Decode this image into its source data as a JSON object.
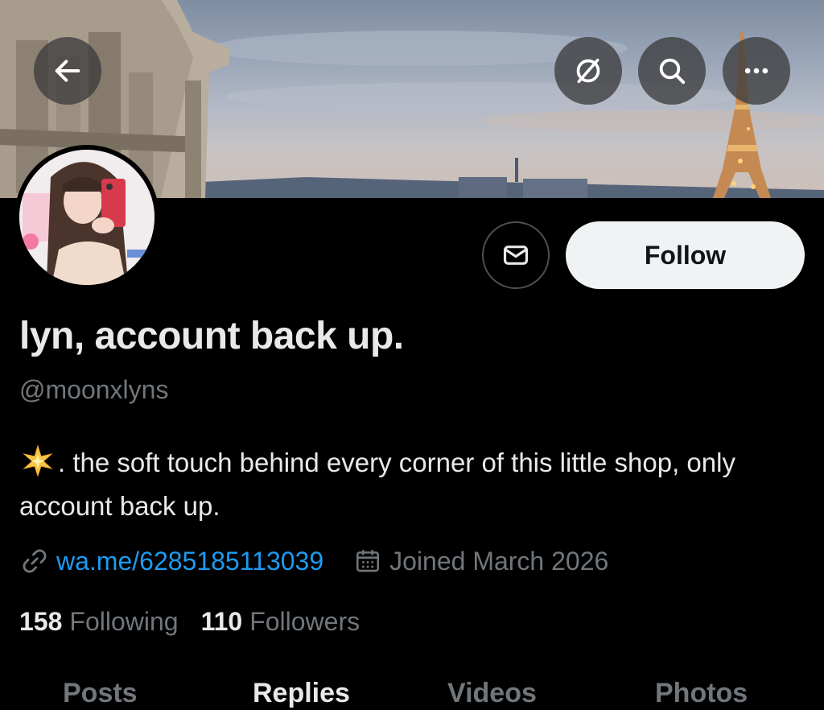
{
  "header": {
    "back_icon": "arrow-left-icon",
    "grok_icon": "grok-slash-circle-icon",
    "search_icon": "search-icon",
    "more_icon": "more-horizontal-icon"
  },
  "profile": {
    "display_name": "lyn, account back up.",
    "handle": "@moonxlyns",
    "bio_emoji": "sparkle-star",
    "bio": ". the soft touch behind every corner of this little shop, only account back up.",
    "link": "wa.me/6285185113039",
    "joined": "Joined March 2026",
    "following_count": "158",
    "following_label": "Following",
    "followers_count": "110",
    "followers_label": "Followers"
  },
  "actions": {
    "message_icon": "envelope-icon",
    "follow_label": "Follow"
  },
  "tabs": [
    {
      "label": "Posts",
      "active": false
    },
    {
      "label": "Replies",
      "active": true
    },
    {
      "label": "Videos",
      "active": false
    },
    {
      "label": "Photos",
      "active": false
    }
  ],
  "colors": {
    "background": "#000000",
    "text": "#e7e9ea",
    "muted": "#71767b",
    "link": "#1d9bf0",
    "follow_bg": "#eff3f4"
  }
}
